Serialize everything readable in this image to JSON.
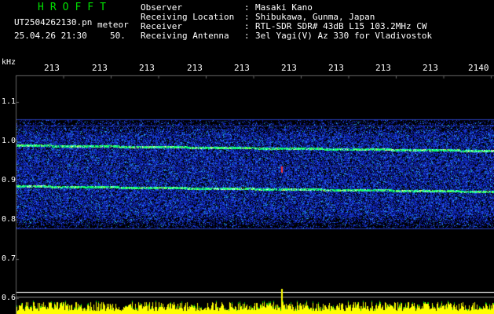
{
  "header": {
    "brand": "HROFFT",
    "file_name": "UT2504262130.pn",
    "mode": "meteor",
    "datetime": "25.04.26 21:30",
    "rate": "50."
  },
  "info": [
    {
      "key": "Observer",
      "colon": ":",
      "value": "Masaki Kano"
    },
    {
      "key": "Receiving Location",
      "colon": ":",
      "value": "Shibukawa, Gunma, Japan"
    },
    {
      "key": "Receiver",
      "colon": ":",
      "value": "RTL-SDR SDR# 43dB L15 103.2MHz CW"
    },
    {
      "key": "Receiving Antenna",
      "colon": ":",
      "value": "3el Yagi(V) Az 330 for Vladivostok"
    }
  ],
  "y_axis": {
    "unit": "kHz",
    "ticks": [
      "1.1",
      "1.0",
      "0.9",
      "0.8",
      "0.7",
      "0.6"
    ]
  },
  "x_axis": {
    "ticks": [
      "213",
      "213",
      "213",
      "213",
      "213",
      "213",
      "213",
      "213",
      "213",
      "2140"
    ]
  },
  "colors": {
    "background": "#000000",
    "noise": "#1428c8",
    "trace": "#00ff66",
    "signal_bar": "#ffff00",
    "brand": "#00e000"
  }
}
